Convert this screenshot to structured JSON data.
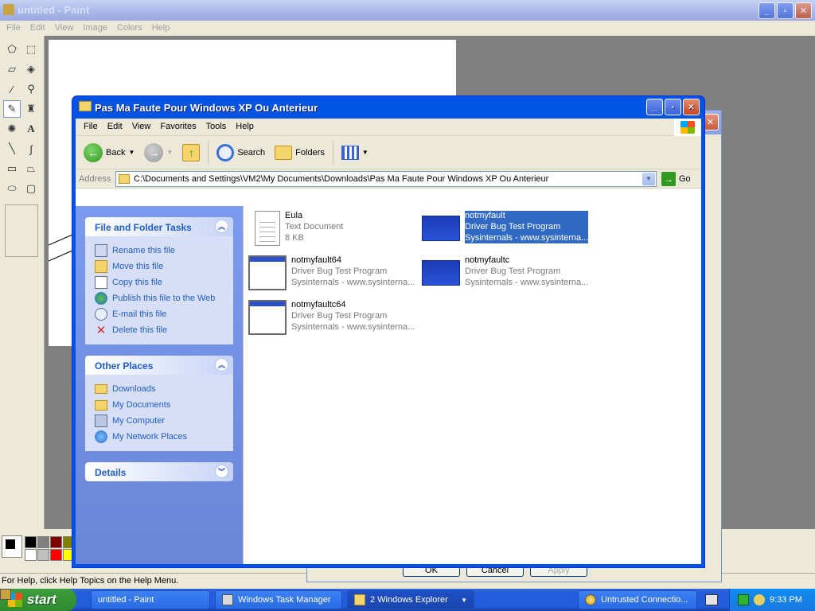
{
  "paint": {
    "title": "untitled - Paint",
    "menu": [
      "File",
      "Edit",
      "View",
      "Image",
      "Colors",
      "Help"
    ],
    "status": "For Help, click Help Topics on the Help Menu."
  },
  "taskmgr": {
    "buttons": [
      "OK",
      "Cancel",
      "Apply"
    ]
  },
  "explorer": {
    "title": "Pas Ma Faute Pour Windows XP Ou Anterieur",
    "menu": [
      "File",
      "Edit",
      "View",
      "Favorites",
      "Tools",
      "Help"
    ],
    "toolbar": {
      "back": "Back",
      "search": "Search",
      "folders": "Folders"
    },
    "address": {
      "label": "Address",
      "value": "C:\\Documents and Settings\\VM2\\My Documents\\Downloads\\Pas Ma Faute Pour Windows XP Ou Anterieur",
      "go": "Go"
    },
    "panels": {
      "file_tasks": {
        "title": "File and Folder Tasks",
        "items": [
          "Rename this file",
          "Move this file",
          "Copy this file",
          "Publish this file to the Web",
          "E-mail this file",
          "Delete this file"
        ]
      },
      "other_places": {
        "title": "Other Places",
        "items": [
          "Downloads",
          "My Documents",
          "My Computer",
          "My Network Places"
        ]
      },
      "details": {
        "title": "Details"
      }
    },
    "files": [
      {
        "name": "Eula",
        "desc": "Text Document",
        "info": "8 KB"
      },
      {
        "name": "notmyfault",
        "desc": "Driver Bug Test Program",
        "info": "Sysinternals - www.sysinterna..."
      },
      {
        "name": "notmyfault64",
        "desc": "Driver Bug Test Program",
        "info": "Sysinternals - www.sysinterna..."
      },
      {
        "name": "notmyfaultc",
        "desc": "Driver Bug Test Program",
        "info": "Sysinternals - www.sysinterna..."
      },
      {
        "name": "notmyfaultc64",
        "desc": "Driver Bug Test Program",
        "info": "Sysinternals - www.sysinterna..."
      }
    ]
  },
  "taskbar": {
    "start": "start",
    "tasks": [
      "untitled - Paint",
      "Windows Task Manager",
      "2 Windows Explorer",
      "Untrusted Connectio..."
    ],
    "clock": "9:33 PM"
  }
}
